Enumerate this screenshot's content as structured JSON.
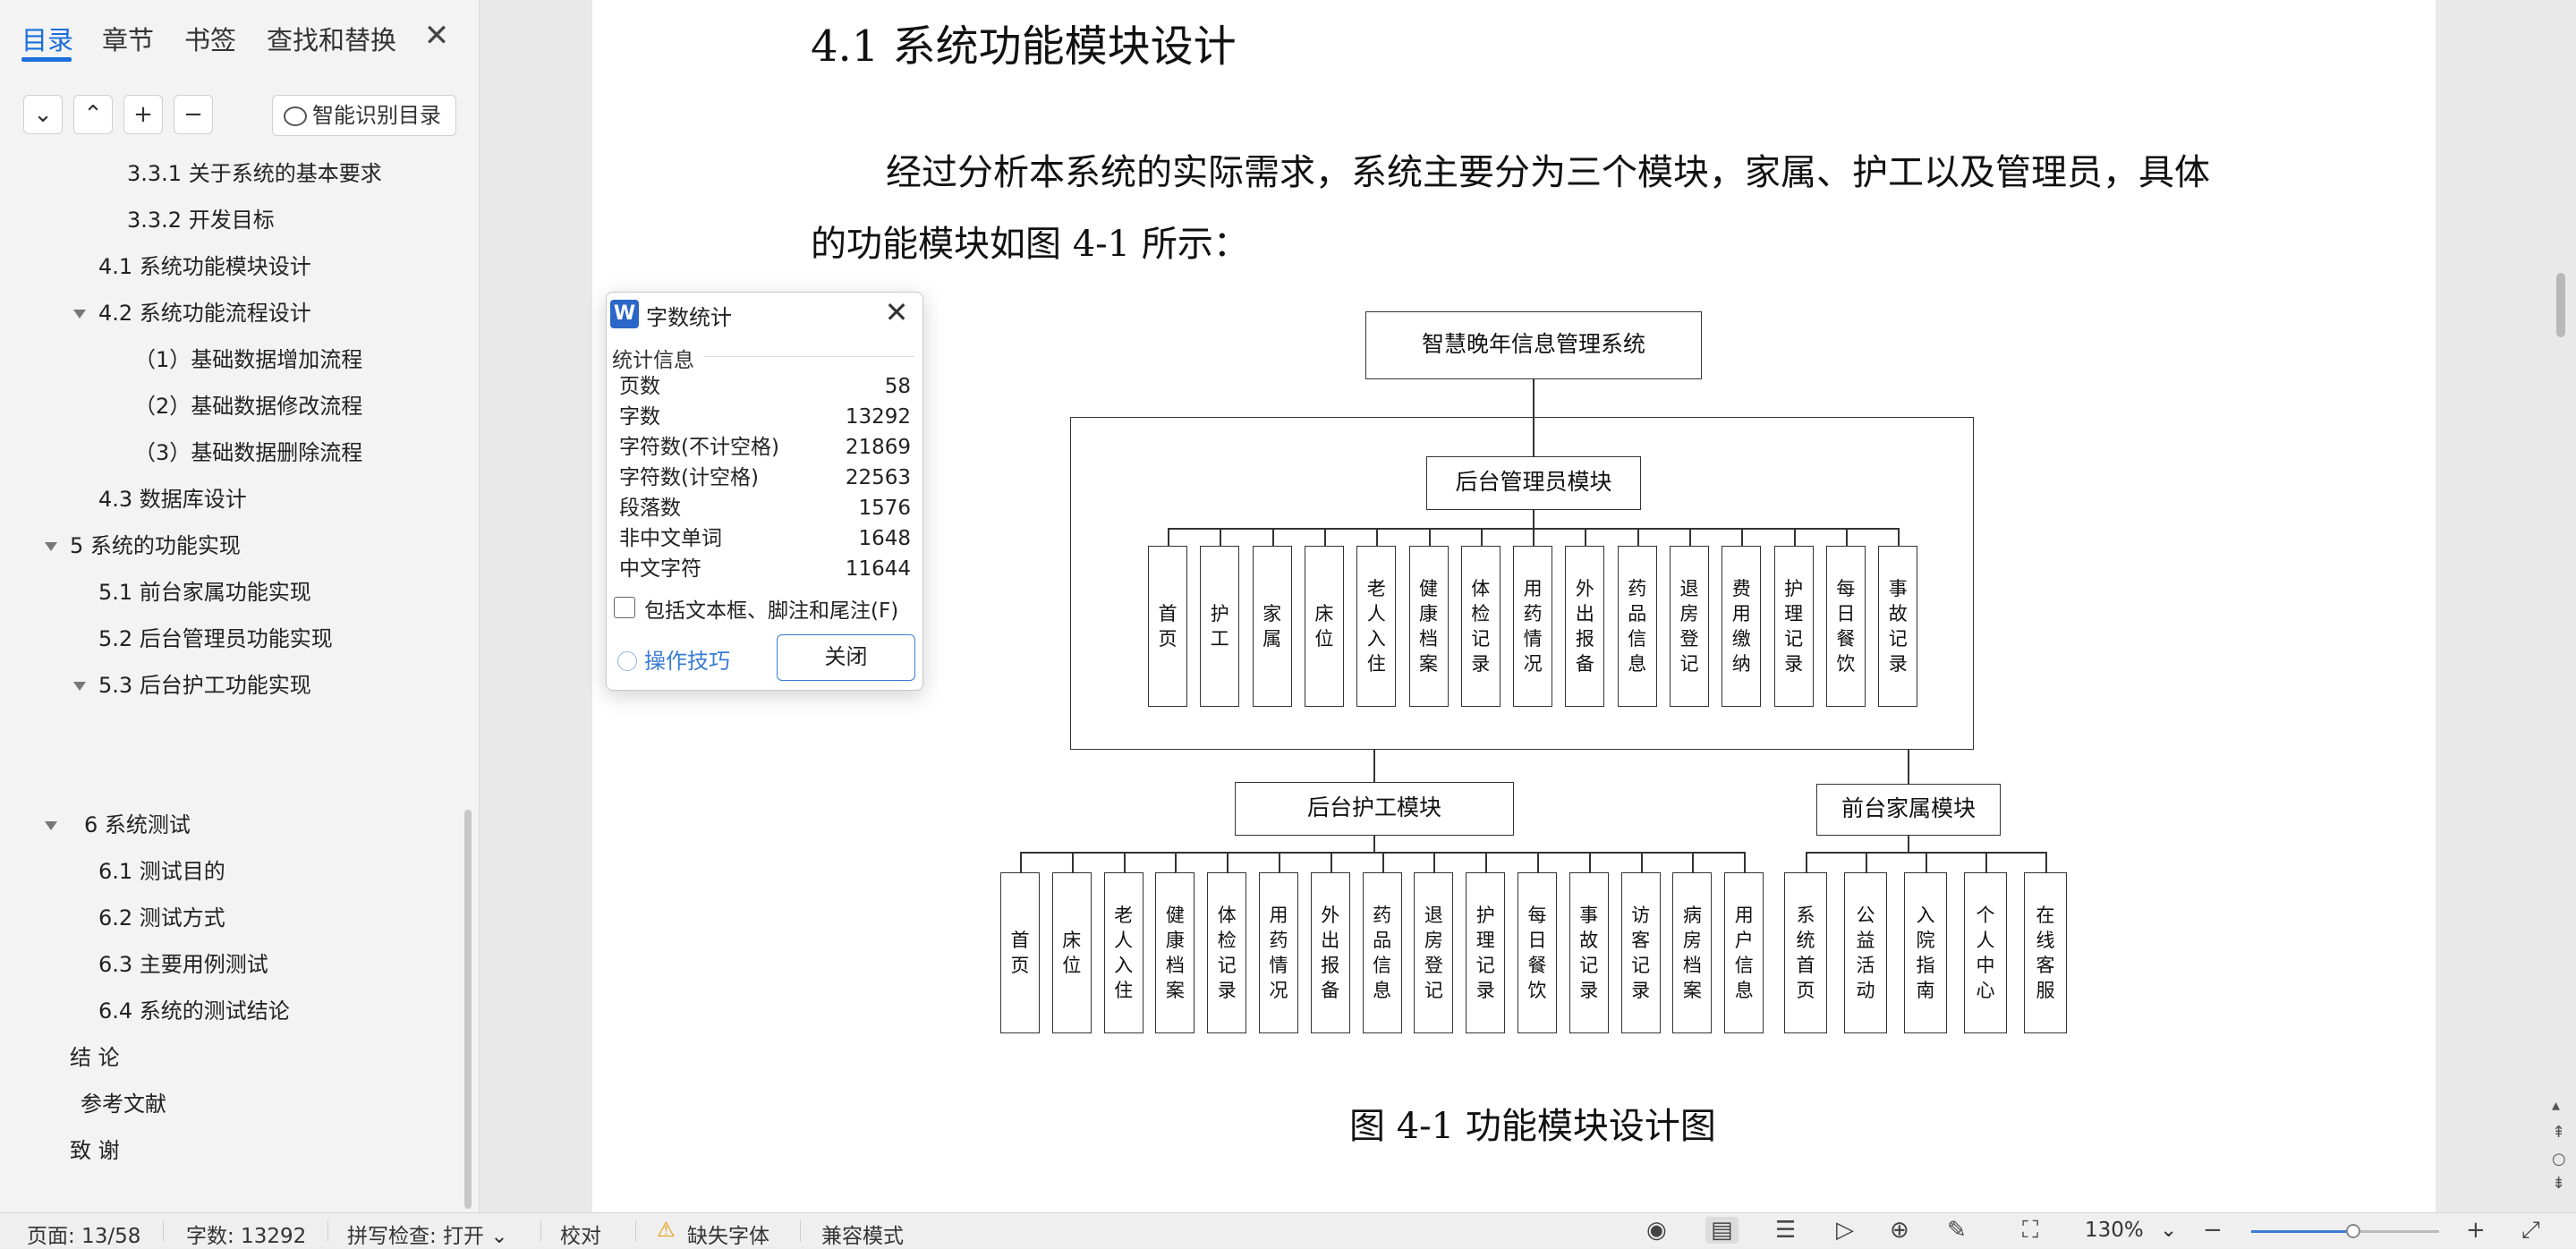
{
  "sidebar": {
    "tabs": [
      "目录",
      "章节",
      "书签",
      "查找和替换"
    ],
    "close_glyph": "✕",
    "tools": {
      "collapse": "⌄",
      "expand": "⌃",
      "add": "+",
      "remove": "−",
      "smart_toc": "智能识别目录"
    },
    "toc": [
      {
        "text": "3.3.1  关于系统的基本要求"
      },
      {
        "text": "3.3.2 开发目标"
      },
      {
        "text": "4.1  系统功能模块设计"
      },
      {
        "text": "4.2  系统功能流程设计"
      },
      {
        "text": "（1）基础数据增加流程"
      },
      {
        "text": "（2）基础数据修改流程"
      },
      {
        "text": "（3）基础数据删除流程"
      },
      {
        "text": "4.3  数据库设计"
      },
      {
        "text": "5 系统的功能实现"
      },
      {
        "text": "5.1 前台家属功能实现"
      },
      {
        "text": "5.2 后台管理员功能实现"
      },
      {
        "text": "5.3 后台护工功能实现"
      },
      {
        "text": "6  系统测试"
      },
      {
        "text": "6.1    测试目的"
      },
      {
        "text": "6.2    测试方式"
      },
      {
        "text": "6.3  主要用例测试"
      },
      {
        "text": "6.4  系统的测试结论"
      },
      {
        "text": "结  论"
      },
      {
        "text": "参考文献"
      },
      {
        "text": "致  谢"
      }
    ]
  },
  "document": {
    "heading": "4.1  系统功能模块设计",
    "para_line1": "经过分析本系统的实际需求，系统主要分为三个模块，家属、护工以及管理员，具体",
    "para_line2": "的功能模块如图 4-1 所示：",
    "caption": "图 4-1  功能模块设计图",
    "diagram": {
      "root": "智慧晚年信息管理系统",
      "admin_module": "后台管理员模块",
      "admin_items": [
        "首页",
        "护工",
        "家属",
        "床位",
        "老人入住",
        "健康档案",
        "体检记录",
        "用药情况",
        "外出报备",
        "药品信息",
        "退房登记",
        "费用缴纳",
        "护理记录",
        "每日餐饮",
        "事故记录"
      ],
      "nurse_module": "后台护工模块",
      "nurse_items": [
        "首页",
        "床位",
        "老人入住",
        "健康档案",
        "体检记录",
        "用药情况",
        "外出报备",
        "药品信息",
        "退房登记",
        "护理记录",
        "每日餐饮",
        "事故记录",
        "访客记录",
        "病房档案",
        "用户信息"
      ],
      "family_module": "前台家属模块",
      "family_items": [
        "系统首页",
        "公益活动",
        "入院指南",
        "个人中心",
        "在线客服"
      ]
    }
  },
  "dialog": {
    "title": "字数统计",
    "logo": "W",
    "section": "统计信息",
    "stats": [
      {
        "label": "页数",
        "value": "58"
      },
      {
        "label": "字数",
        "value": "13292"
      },
      {
        "label": "字符数(不计空格)",
        "value": "21869"
      },
      {
        "label": "字符数(计空格)",
        "value": "22563"
      },
      {
        "label": "段落数",
        "value": "1576"
      },
      {
        "label": "非中文单词",
        "value": "1648"
      },
      {
        "label": "中文字符",
        "value": "11644"
      }
    ],
    "checkbox_label": "包括文本框、脚注和尾注(F)",
    "tips": "操作技巧",
    "close_button": "关闭"
  },
  "statusbar": {
    "page": "页面: 13/58",
    "words": "字数: 13292",
    "spell": "拼写检查: 打开",
    "proof": "校对",
    "missing_font": "缺失字体",
    "compat": "兼容模式",
    "zoom": "130%"
  }
}
